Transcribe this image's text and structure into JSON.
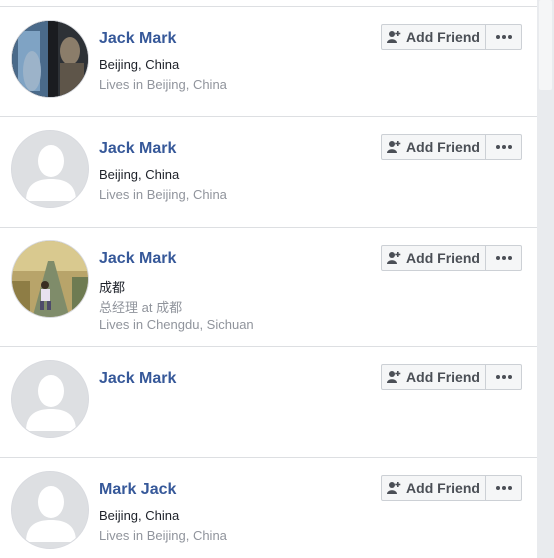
{
  "results": [
    {
      "name": "Jack Mark",
      "lines": [
        "Beijing, China",
        "Lives in Beijing, China"
      ],
      "avatar": "photo-sculpture",
      "add_friend_label": "Add Friend"
    },
    {
      "name": "Jack Mark",
      "lines": [
        "Beijing, China",
        "Lives in Beijing, China"
      ],
      "avatar": "default-silhouette",
      "add_friend_label": "Add Friend"
    },
    {
      "name": "Jack Mark",
      "lines": [
        "成都",
        "总经理 at 成都",
        "Lives in Chengdu, Sichuan"
      ],
      "avatar": "photo-person-walking",
      "add_friend_label": "Add Friend"
    },
    {
      "name": "Jack Mark",
      "lines": [],
      "avatar": "default-silhouette",
      "add_friend_label": "Add Friend"
    },
    {
      "name": "Mark Jack",
      "lines": [
        "Beijing, China",
        "Lives in Beijing, China"
      ],
      "avatar": "default-silhouette",
      "add_friend_label": "Add Friend"
    }
  ],
  "icons": {
    "add_friend": "person-plus-icon",
    "more": "more-dots-icon"
  },
  "colors": {
    "name_link": "#365899",
    "button_bg": "#f5f6f7",
    "button_border": "#ccd0d5",
    "secondary_text": "#90949c",
    "divider": "#dddfe2"
  }
}
